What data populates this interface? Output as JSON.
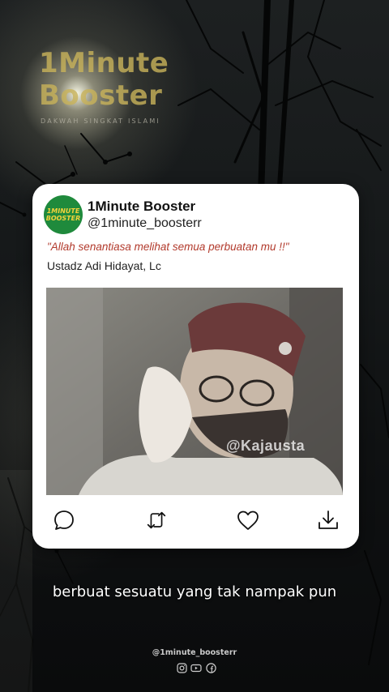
{
  "brand": {
    "title_line1": "1Minute",
    "title_line2": "Booster",
    "tagline": "DAKWAH SINGKAT ISLAMI"
  },
  "post": {
    "avatar_line1": "1MINUTE",
    "avatar_line2": "BOOSTER",
    "account_name": "1Minute Booster",
    "handle": "@1minute_boosterr",
    "quote": "\"Allah senantiasa melihat semua perbuatan mu !!\"",
    "speaker": "Ustadz Adi Hidayat, Lc",
    "video_watermark": "@Kajausta",
    "actions": [
      {
        "icon": "comment-icon"
      },
      {
        "icon": "repost-icon"
      },
      {
        "icon": "heart-icon"
      },
      {
        "icon": "download-icon"
      }
    ]
  },
  "caption": "berbuat sesuatu yang tak nampak pun",
  "footer": {
    "handle": "@1minute_boosterr",
    "socials": [
      "instagram-icon",
      "youtube-icon",
      "facebook-icon"
    ]
  },
  "colors": {
    "brand_gold": "#c9b35a",
    "avatar_green": "#1f8a3c",
    "avatar_text": "#f3d33b",
    "quote_red": "#b23a2c"
  }
}
